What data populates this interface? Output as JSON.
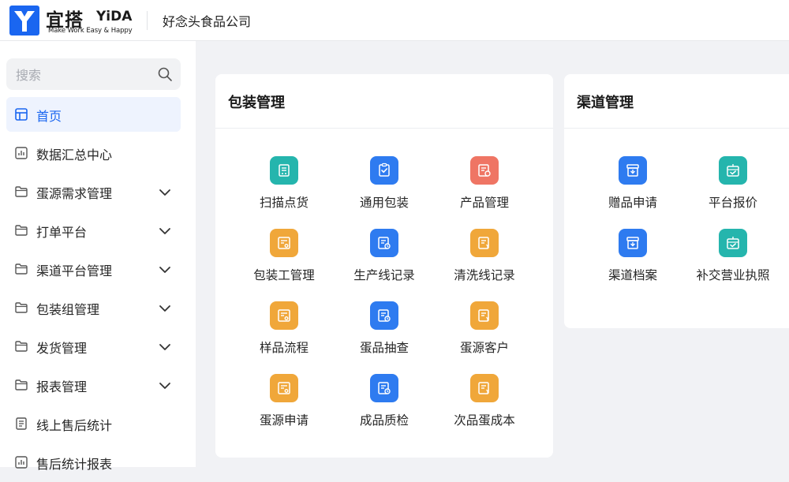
{
  "header": {
    "logo_cn": "宜搭",
    "logo_en": "YiDA",
    "logo_slogan": "Make Work Easy & Happy",
    "company": "好念头食品公司"
  },
  "colors": {
    "primary": "#1a66f0",
    "teal": "#25b5ad",
    "blue": "#2e7bf0",
    "orange": "#f0a73a",
    "coral": "#ef7564"
  },
  "sidebar": {
    "search": {
      "placeholder": "搜索",
      "value": "",
      "icon": "search-icon"
    },
    "items": [
      {
        "label": "首页",
        "icon": "home-icon",
        "active": true,
        "expandable": false
      },
      {
        "label": "数据汇总中心",
        "icon": "report-icon",
        "expandable": false
      },
      {
        "label": "蛋源需求管理",
        "icon": "folder-icon",
        "expandable": true
      },
      {
        "label": "打单平台",
        "icon": "folder-icon",
        "expandable": true
      },
      {
        "label": "渠道平台管理",
        "icon": "folder-icon",
        "expandable": true
      },
      {
        "label": "包装组管理",
        "icon": "folder-icon",
        "expandable": true
      },
      {
        "label": "发货管理",
        "icon": "folder-icon",
        "expandable": true
      },
      {
        "label": "报表管理",
        "icon": "folder-icon",
        "expandable": true
      },
      {
        "label": "线上售后统计",
        "icon": "form-icon",
        "expandable": false
      },
      {
        "label": "售后统计报表",
        "icon": "report-icon",
        "expandable": false
      }
    ]
  },
  "packaging": {
    "title": "包装管理",
    "apps": [
      {
        "label": "扫描点货",
        "icon": "cart-icon",
        "color": "teal"
      },
      {
        "label": "通用包装",
        "icon": "checklist-icon",
        "color": "blue"
      },
      {
        "label": "产品管理",
        "icon": "doc-gear-icon",
        "color": "coral"
      },
      {
        "label": "包装工管理",
        "icon": "doc-person-icon",
        "color": "orange"
      },
      {
        "label": "生产线记录",
        "icon": "doc-clock-icon",
        "color": "blue"
      },
      {
        "label": "清洗线记录",
        "icon": "doc-yen-icon",
        "color": "orange"
      },
      {
        "label": "样品流程",
        "icon": "doc-person-icon",
        "color": "orange"
      },
      {
        "label": "蛋品抽查",
        "icon": "doc-clock-icon",
        "color": "blue"
      },
      {
        "label": "蛋源客户",
        "icon": "doc-yen-icon",
        "color": "orange"
      },
      {
        "label": "蛋源申请",
        "icon": "doc-person-icon",
        "color": "orange"
      },
      {
        "label": "成品质检",
        "icon": "doc-clock-icon",
        "color": "blue"
      },
      {
        "label": "次品蛋成本",
        "icon": "doc-yen-icon",
        "color": "orange"
      }
    ]
  },
  "channels": {
    "title": "渠道管理",
    "apps": [
      {
        "label": "赠品申请",
        "icon": "archive-icon",
        "color": "blue"
      },
      {
        "label": "平台报价",
        "icon": "inbox-check-icon",
        "color": "teal"
      },
      {
        "label": "渠道档案",
        "icon": "archive-icon",
        "color": "blue"
      },
      {
        "label": "补交营业执照",
        "icon": "inbox-check-icon",
        "color": "teal"
      }
    ]
  }
}
